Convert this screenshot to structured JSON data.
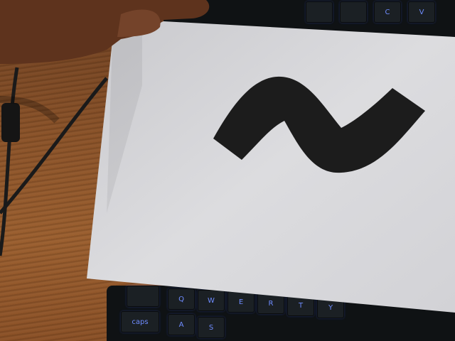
{
  "scene": {
    "description_colors": {
      "paper": "#d9d9db",
      "desk": "#8a5228",
      "keyboard": "#0f1214",
      "key_legend": "#6f8cff",
      "symbol": "#1c1c1c",
      "skin": "#6b3a22"
    },
    "symbol_icon": "tilde-icon",
    "keyboard_top_keys": [
      "",
      "",
      "C",
      "V"
    ],
    "keyboard_bottom_row1": [
      "",
      "Q",
      "W",
      "E",
      "R",
      "T",
      "Y"
    ],
    "keyboard_bottom_row2": [
      "caps",
      "A",
      "S"
    ]
  }
}
